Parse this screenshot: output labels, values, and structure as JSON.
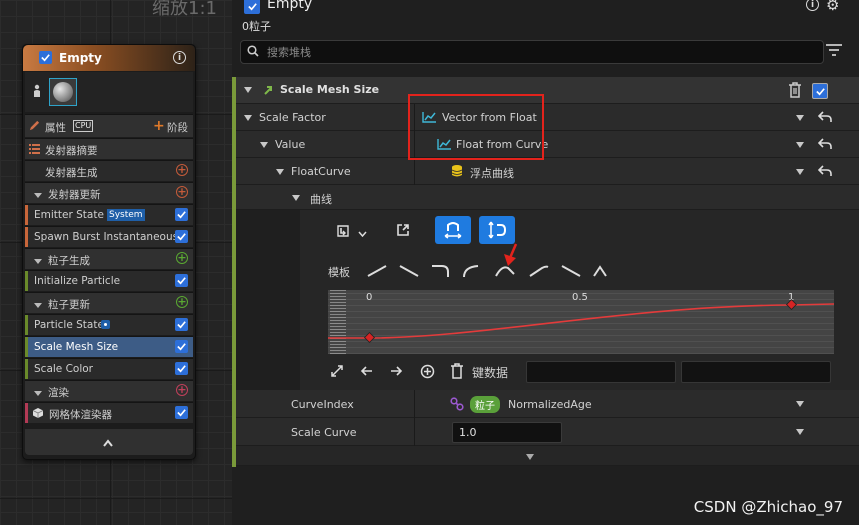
{
  "graph": {
    "zoom_label": "缩放1:1"
  },
  "emitter": {
    "title": "Empty",
    "props_label": "属性",
    "cpu_label": "CPU",
    "stage_label": "阶段",
    "sections": [
      {
        "label": "发射器摘要"
      },
      {
        "label": "发射器生成"
      },
      {
        "label": "发射器更新"
      }
    ],
    "emitter_state": {
      "label": "Emitter State",
      "tag": "System"
    },
    "spawn_burst": "Spawn Burst Instantaneous",
    "particle_spawn": "粒子生成",
    "initialize": "Initialize Particle",
    "particle_update": "粒子更新",
    "particle_state": "Particle State",
    "scale_mesh": "Scale Mesh Size",
    "scale_color": "Scale Color",
    "render": "渲染",
    "mesh_renderer": "网格体渲染器"
  },
  "details": {
    "title": "Empty",
    "subtitle": "0粒子",
    "search_placeholder": "搜索堆栈",
    "module_title": "Scale Mesh Size",
    "rows": {
      "scale_factor": "Scale Factor",
      "scale_factor_value": "Vector from Float",
      "value": "Value",
      "value_value": "Float from Curve",
      "float_curve": "FloatCurve",
      "float_curve_value": "浮点曲线",
      "curve": "曲线",
      "template_label": "模板",
      "key_data_label": "键数据",
      "curve_index": "CurveIndex",
      "curve_index_tag": "粒子",
      "curve_index_value": "NormalizedAge",
      "scale_curve": "Scale Curve",
      "scale_curve_value": "1.0"
    },
    "curve_axis": {
      "x0": "0",
      "x05": "0.5",
      "x1": "1"
    }
  },
  "chart_data": {
    "type": "line",
    "x": [
      0,
      0.5,
      1
    ],
    "series": [
      {
        "values": [
          0,
          0.5,
          1
        ]
      }
    ]
  },
  "watermark": "CSDN @Zhichao_97",
  "colors": {
    "accent": "#1f7be0",
    "highlight": "#e3231c",
    "module_green": "#7a9a3a"
  }
}
